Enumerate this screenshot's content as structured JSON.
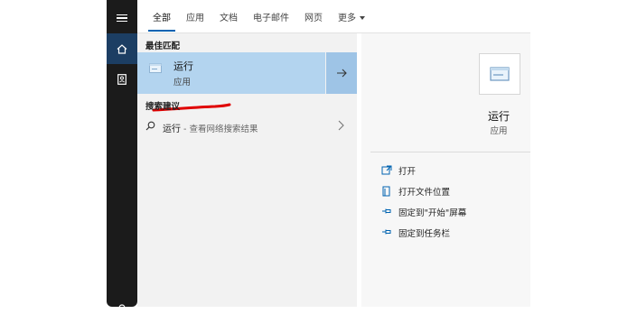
{
  "tabs": [
    {
      "label": "全部",
      "active": true
    },
    {
      "label": "应用"
    },
    {
      "label": "文档"
    },
    {
      "label": "电子邮件"
    },
    {
      "label": "网页"
    },
    {
      "label": "更多"
    }
  ],
  "sidebar": {
    "icons": [
      "hamburger-menu-icon",
      "home-icon",
      "contact-card-icon",
      "user-icon"
    ]
  },
  "best_match": {
    "section_title": "最佳匹配",
    "title": "运行",
    "subtitle": "应用",
    "icon": "run-app-icon",
    "arrow_icon": "arrow-right-icon"
  },
  "suggestions": {
    "section_title": "搜索建议",
    "items": [
      {
        "term": "运行",
        "hint": " - 查看网络搜索结果",
        "icon": "search-icon"
      }
    ]
  },
  "detail": {
    "title": "运行",
    "subtitle": "应用",
    "actions": [
      {
        "label": "打开",
        "icon": "open-icon"
      },
      {
        "label": "打开文件位置",
        "icon": "file-location-icon"
      },
      {
        "label": "固定到\"开始\"屏幕",
        "icon": "pin-icon"
      },
      {
        "label": "固定到任务栏",
        "icon": "pin-icon"
      }
    ]
  },
  "colors": {
    "accent": "#0063b1",
    "selected_row": "#b3d4ef",
    "annotation_red": "#e00000",
    "rail": "#1b1b1b"
  }
}
